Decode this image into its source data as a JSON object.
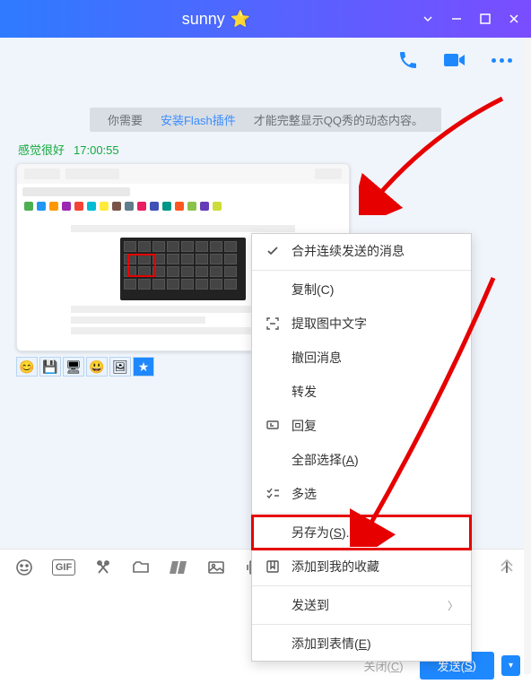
{
  "titlebar": {
    "title": "sunny"
  },
  "notice": {
    "prefix": "你需要",
    "link": "安装Flash插件",
    "suffix": "才能完整显示QQ秀的动态内容。"
  },
  "meta": {
    "name": "感觉很好",
    "time": "17:00:55"
  },
  "iconrow": [
    "😊",
    "💾",
    "🖥",
    "😃",
    "🖼",
    "★"
  ],
  "context_menu": {
    "merge": "合并连续发送的消息",
    "copy": "复制(C)",
    "extract": "提取图中文字",
    "recall": "撤回消息",
    "forward": "转发",
    "reply": "回复",
    "selectall_pre": "全部选择(",
    "selectall_key": "A",
    "selectall_post": ")",
    "multi": "多选",
    "saveas_pre": "另存为(",
    "saveas_key": "S",
    "saveas_post": ")...",
    "fav": "添加到我的收藏",
    "sendto": "发送到",
    "addemoji_pre": "添加到表情(",
    "addemoji_key": "E",
    "addemoji_post": ")"
  },
  "bottom": {
    "close_pre": "关闭(",
    "close_key": "C",
    "close_post": ")",
    "send_pre": "发送(",
    "send_key": "S",
    "send_post": ")"
  }
}
